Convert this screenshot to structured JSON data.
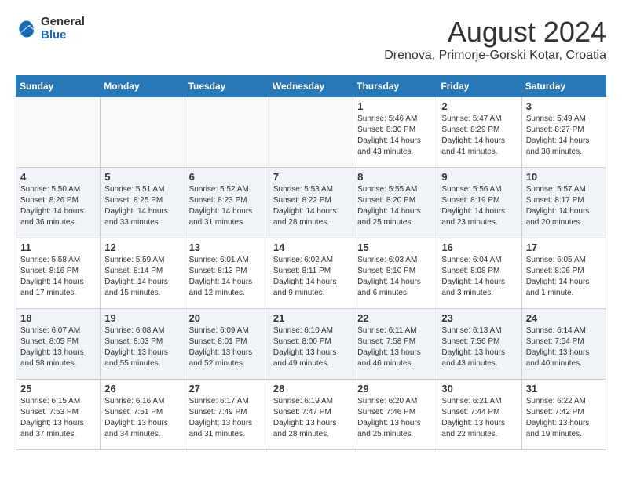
{
  "logo": {
    "general": "General",
    "blue": "Blue"
  },
  "title": {
    "month_year": "August 2024",
    "location": "Drenova, Primorje-Gorski Kotar, Croatia"
  },
  "headers": [
    "Sunday",
    "Monday",
    "Tuesday",
    "Wednesday",
    "Thursday",
    "Friday",
    "Saturday"
  ],
  "weeks": [
    [
      {
        "day": "",
        "info": ""
      },
      {
        "day": "",
        "info": ""
      },
      {
        "day": "",
        "info": ""
      },
      {
        "day": "",
        "info": ""
      },
      {
        "day": "1",
        "info": "Sunrise: 5:46 AM\nSunset: 8:30 PM\nDaylight: 14 hours\nand 43 minutes."
      },
      {
        "day": "2",
        "info": "Sunrise: 5:47 AM\nSunset: 8:29 PM\nDaylight: 14 hours\nand 41 minutes."
      },
      {
        "day": "3",
        "info": "Sunrise: 5:49 AM\nSunset: 8:27 PM\nDaylight: 14 hours\nand 38 minutes."
      }
    ],
    [
      {
        "day": "4",
        "info": "Sunrise: 5:50 AM\nSunset: 8:26 PM\nDaylight: 14 hours\nand 36 minutes."
      },
      {
        "day": "5",
        "info": "Sunrise: 5:51 AM\nSunset: 8:25 PM\nDaylight: 14 hours\nand 33 minutes."
      },
      {
        "day": "6",
        "info": "Sunrise: 5:52 AM\nSunset: 8:23 PM\nDaylight: 14 hours\nand 31 minutes."
      },
      {
        "day": "7",
        "info": "Sunrise: 5:53 AM\nSunset: 8:22 PM\nDaylight: 14 hours\nand 28 minutes."
      },
      {
        "day": "8",
        "info": "Sunrise: 5:55 AM\nSunset: 8:20 PM\nDaylight: 14 hours\nand 25 minutes."
      },
      {
        "day": "9",
        "info": "Sunrise: 5:56 AM\nSunset: 8:19 PM\nDaylight: 14 hours\nand 23 minutes."
      },
      {
        "day": "10",
        "info": "Sunrise: 5:57 AM\nSunset: 8:17 PM\nDaylight: 14 hours\nand 20 minutes."
      }
    ],
    [
      {
        "day": "11",
        "info": "Sunrise: 5:58 AM\nSunset: 8:16 PM\nDaylight: 14 hours\nand 17 minutes."
      },
      {
        "day": "12",
        "info": "Sunrise: 5:59 AM\nSunset: 8:14 PM\nDaylight: 14 hours\nand 15 minutes."
      },
      {
        "day": "13",
        "info": "Sunrise: 6:01 AM\nSunset: 8:13 PM\nDaylight: 14 hours\nand 12 minutes."
      },
      {
        "day": "14",
        "info": "Sunrise: 6:02 AM\nSunset: 8:11 PM\nDaylight: 14 hours\nand 9 minutes."
      },
      {
        "day": "15",
        "info": "Sunrise: 6:03 AM\nSunset: 8:10 PM\nDaylight: 14 hours\nand 6 minutes."
      },
      {
        "day": "16",
        "info": "Sunrise: 6:04 AM\nSunset: 8:08 PM\nDaylight: 14 hours\nand 3 minutes."
      },
      {
        "day": "17",
        "info": "Sunrise: 6:05 AM\nSunset: 8:06 PM\nDaylight: 14 hours\nand 1 minute."
      }
    ],
    [
      {
        "day": "18",
        "info": "Sunrise: 6:07 AM\nSunset: 8:05 PM\nDaylight: 13 hours\nand 58 minutes."
      },
      {
        "day": "19",
        "info": "Sunrise: 6:08 AM\nSunset: 8:03 PM\nDaylight: 13 hours\nand 55 minutes."
      },
      {
        "day": "20",
        "info": "Sunrise: 6:09 AM\nSunset: 8:01 PM\nDaylight: 13 hours\nand 52 minutes."
      },
      {
        "day": "21",
        "info": "Sunrise: 6:10 AM\nSunset: 8:00 PM\nDaylight: 13 hours\nand 49 minutes."
      },
      {
        "day": "22",
        "info": "Sunrise: 6:11 AM\nSunset: 7:58 PM\nDaylight: 13 hours\nand 46 minutes."
      },
      {
        "day": "23",
        "info": "Sunrise: 6:13 AM\nSunset: 7:56 PM\nDaylight: 13 hours\nand 43 minutes."
      },
      {
        "day": "24",
        "info": "Sunrise: 6:14 AM\nSunset: 7:54 PM\nDaylight: 13 hours\nand 40 minutes."
      }
    ],
    [
      {
        "day": "25",
        "info": "Sunrise: 6:15 AM\nSunset: 7:53 PM\nDaylight: 13 hours\nand 37 minutes."
      },
      {
        "day": "26",
        "info": "Sunrise: 6:16 AM\nSunset: 7:51 PM\nDaylight: 13 hours\nand 34 minutes."
      },
      {
        "day": "27",
        "info": "Sunrise: 6:17 AM\nSunset: 7:49 PM\nDaylight: 13 hours\nand 31 minutes."
      },
      {
        "day": "28",
        "info": "Sunrise: 6:19 AM\nSunset: 7:47 PM\nDaylight: 13 hours\nand 28 minutes."
      },
      {
        "day": "29",
        "info": "Sunrise: 6:20 AM\nSunset: 7:46 PM\nDaylight: 13 hours\nand 25 minutes."
      },
      {
        "day": "30",
        "info": "Sunrise: 6:21 AM\nSunset: 7:44 PM\nDaylight: 13 hours\nand 22 minutes."
      },
      {
        "day": "31",
        "info": "Sunrise: 6:22 AM\nSunset: 7:42 PM\nDaylight: 13 hours\nand 19 minutes."
      }
    ]
  ]
}
